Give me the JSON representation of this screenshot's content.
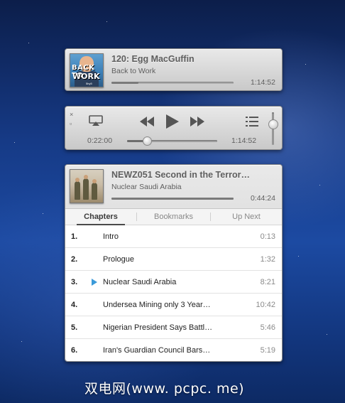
{
  "colors": {
    "accent": "#3b9ad9",
    "text_primary": "#5e5e5e",
    "panel": "#d7d7d7"
  },
  "mini_player": {
    "title": "120: Egg MacGuffin",
    "podcast": "Back to Work",
    "duration": "1:14:52",
    "progress_fraction": 0.22,
    "artwork": {
      "icon": "back-to-work-artwork",
      "line1": "BACK TO",
      "line2": "WORK",
      "line3": "5by5"
    }
  },
  "controls": {
    "close_icon": "×",
    "minimize_icon": "▫",
    "airplay_icon": "airplay-icon",
    "rewind_icon": "rewind-icon",
    "play_icon": "play-icon",
    "forward_icon": "fast-forward-icon",
    "list_icon": "list-icon",
    "elapsed": "0:22:00",
    "total": "1:14:52",
    "seek_fraction": 0.22,
    "volume_fraction": 0.7
  },
  "episode_panel": {
    "title": "NEWZ051 Second in the Terror…",
    "chapter": "Nuclear Saudi Arabia",
    "duration": "0:44:24",
    "progress_fraction": 1.0,
    "tabs": [
      {
        "label": "Chapters",
        "active": true
      },
      {
        "label": "Bookmarks",
        "active": false
      },
      {
        "label": "Up Next",
        "active": false
      }
    ],
    "chapters": [
      {
        "num": "1.",
        "name": "Intro",
        "time": "0:13",
        "playing": false
      },
      {
        "num": "2.",
        "name": "Prologue",
        "time": "1:32",
        "playing": false
      },
      {
        "num": "3.",
        "name": "Nuclear Saudi Arabia",
        "time": "8:21",
        "playing": true
      },
      {
        "num": "4.",
        "name": "Undersea Mining only 3 Year…",
        "time": "10:42",
        "playing": false
      },
      {
        "num": "5.",
        "name": "Nigerian President Says Battl…",
        "time": "5:46",
        "playing": false
      },
      {
        "num": "6.",
        "name": "Iran's Guardian Council Bars…",
        "time": "5:19",
        "playing": false
      }
    ]
  },
  "watermark": "双电网(www. pcpc. me)"
}
